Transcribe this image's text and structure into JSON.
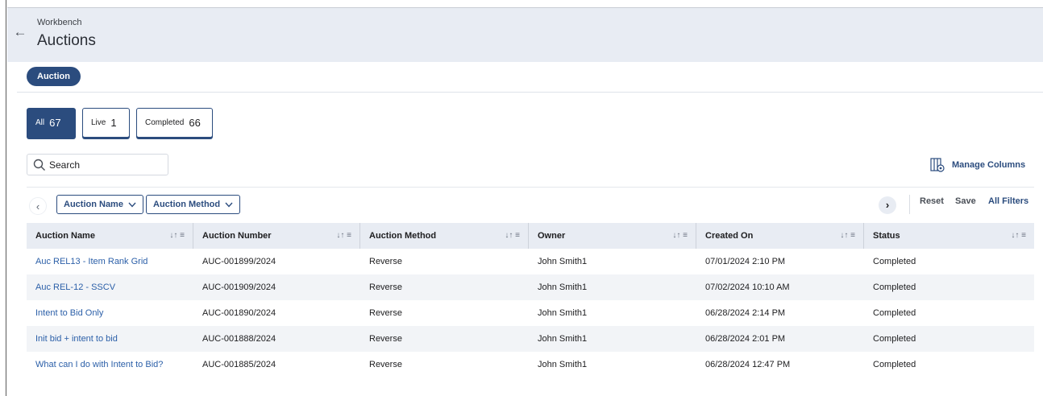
{
  "header": {
    "breadcrumb": "Workbench",
    "title": "Auctions",
    "back_icon": "←"
  },
  "tabs": [
    {
      "label": "Auction",
      "active": true
    }
  ],
  "counts": [
    {
      "label": "All",
      "value": "67",
      "active": true
    },
    {
      "label": "Live",
      "value": "1",
      "active": false
    },
    {
      "label": "Completed",
      "value": "66",
      "active": false
    }
  ],
  "search": {
    "placeholder": "Search",
    "value": ""
  },
  "toolbar": {
    "manage_columns": "Manage Columns",
    "filters": [
      "Auction Name",
      "Auction Method"
    ],
    "reset": "Reset",
    "save": "Save",
    "all_filters": "All Filters",
    "scroll_left": "‹",
    "scroll_right": "›"
  },
  "table": {
    "columns": [
      "Auction Name",
      "Auction Number",
      "Auction Method",
      "Owner",
      "Created On",
      "Status"
    ],
    "sort_glyph": "↓↑ ≡",
    "rows": [
      [
        "Auc REL13 - Item Rank Grid",
        "AUC-001899/2024",
        "Reverse",
        "John Smith1",
        "07/01/2024 2:10 PM",
        "Completed"
      ],
      [
        "Auc REL-12 - SSCV",
        "AUC-001909/2024",
        "Reverse",
        "John Smith1",
        "07/02/2024 10:10 AM",
        "Completed"
      ],
      [
        "Intent to Bid Only",
        "AUC-001890/2024",
        "Reverse",
        "John Smith1",
        "06/28/2024 2:14 PM",
        "Completed"
      ],
      [
        "Init bid + intent to bid",
        "AUC-001888/2024",
        "Reverse",
        "John Smith1",
        "06/28/2024 2:01 PM",
        "Completed"
      ],
      [
        "What can I do with Intent to Bid?",
        "AUC-001885/2024",
        "Reverse",
        "John Smith1",
        "06/28/2024 12:47 PM",
        "Completed"
      ]
    ]
  },
  "colors": {
    "primary": "#2b4c7e",
    "link": "#2b5fa8",
    "header_bg": "#e8ecf3",
    "alt_row": "#f2f4f7"
  }
}
